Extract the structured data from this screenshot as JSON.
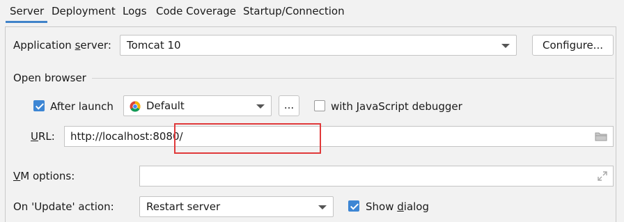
{
  "tabs": [
    {
      "label": "Server",
      "active": true
    },
    {
      "label": "Deployment",
      "active": false
    },
    {
      "label": "Logs",
      "active": false
    },
    {
      "label": "Code Coverage",
      "active": false
    },
    {
      "label": "Startup/Connection",
      "active": false
    }
  ],
  "app_server": {
    "label": "Application server:",
    "value": "Tomcat 10",
    "configure_label": "Configure..."
  },
  "open_browser": {
    "section_label": "Open browser",
    "after_launch_label": "After launch",
    "after_launch_checked": true,
    "browser_value": "Default",
    "browser_icon": "chrome-icon",
    "more_button_label": "...",
    "js_debugger_label": "with JavaScript debugger",
    "js_debugger_checked": false,
    "url_label": "URL:",
    "url_value": "http://localhost:8080/",
    "folder_icon": "folder-icon"
  },
  "vm_options": {
    "label": "VM options:",
    "value": "",
    "expand_icon": "expand-icon"
  },
  "update_action": {
    "label": "On 'Update' action:",
    "value": "Restart server",
    "show_dialog_label": "Show dialog",
    "show_dialog_checked": true
  },
  "colors": {
    "accent": "#3d86d4",
    "highlight_box": "#e0393a",
    "background": "#f2f2f2"
  }
}
